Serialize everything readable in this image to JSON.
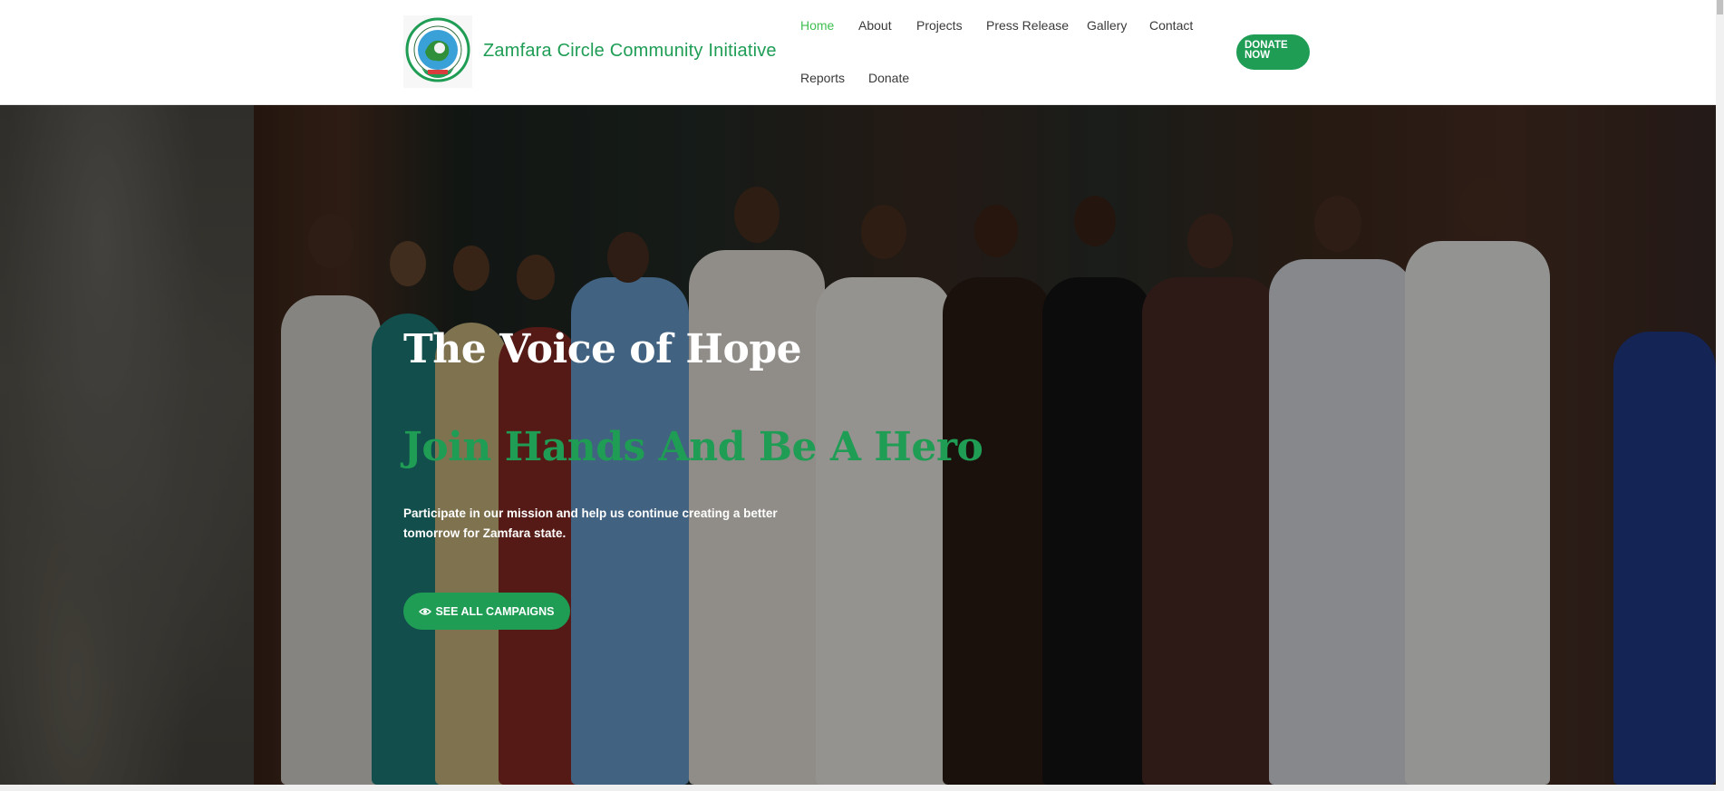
{
  "header": {
    "site_title": "Zamfara Circle Community Initiative",
    "logo_icon": "zamfara-circle-logo",
    "nav": [
      {
        "label": "Home",
        "active": true
      },
      {
        "label": "About",
        "active": false
      },
      {
        "label": "Projects",
        "active": false
      },
      {
        "label": "Press Release",
        "active": false
      },
      {
        "label": "Gallery",
        "active": false
      },
      {
        "label": "Contact",
        "active": false
      },
      {
        "label": "Reports",
        "active": false
      },
      {
        "label": "Donate",
        "active": false
      }
    ],
    "donate_button": "DONATE\nNOW"
  },
  "hero": {
    "title": "The Voice of Hope",
    "subtitle": "Join Hands And Be A Hero",
    "text": "Participate in our mission and help us continue creating a better tomorrow for Zamfara state.",
    "button_label": "SEE ALL CAMPAIGNS",
    "button_icon": "eye-icon"
  },
  "colors": {
    "brand_green": "#1f9d55",
    "nav_active": "#3fbf52",
    "nav_text": "#3a3a3a"
  }
}
